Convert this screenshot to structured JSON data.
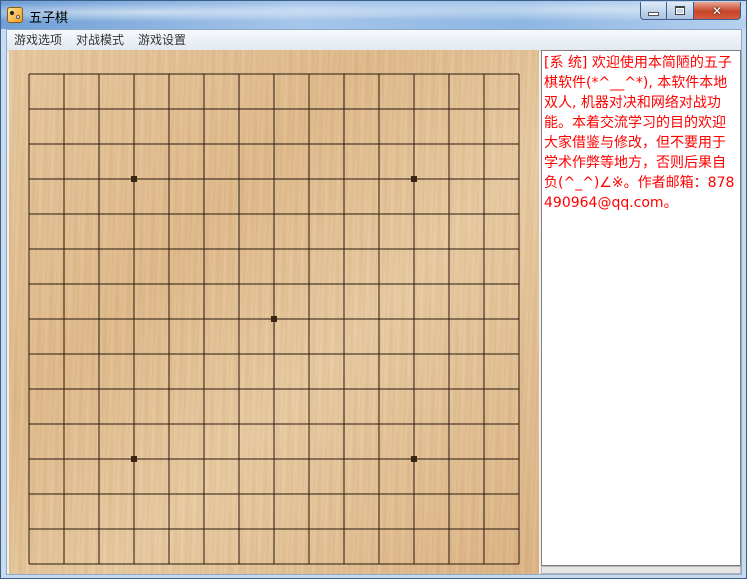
{
  "window": {
    "title": "五子棋",
    "controls": {
      "minimize": "minimize",
      "maximize": "maximize",
      "close": "✕"
    }
  },
  "menu": {
    "items": [
      {
        "label": "游戏选项"
      },
      {
        "label": "对战模式"
      },
      {
        "label": "游戏设置"
      }
    ]
  },
  "board": {
    "lines": 15,
    "star_points": [
      [
        3,
        3
      ],
      [
        3,
        11
      ],
      [
        7,
        7
      ],
      [
        11,
        3
      ],
      [
        11,
        11
      ]
    ],
    "line_color": "#2a1a0d",
    "star_color": "#3a2414"
  },
  "chat": {
    "message": "[系 统] 欢迎使用本简陋的五子棋软件(*^__^*), 本软件本地双人, 机器对决和网络对战功能。本着交流学习的目的欢迎大家借鉴与修改，但不要用于学术作弊等地方，否则后果自负(^_^)∠※。作者邮箱：878490964@qq.com。",
    "text_color": "#ff0000"
  }
}
